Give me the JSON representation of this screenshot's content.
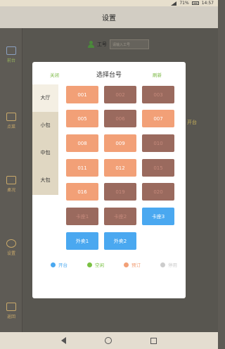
{
  "status_bar": {
    "battery": "71%",
    "time": "14:57"
  },
  "header": {
    "title": "设置"
  },
  "employee": {
    "label": "工号",
    "placeholder": "请输入工号"
  },
  "sidebar": {
    "items": [
      {
        "label": "前台",
        "icon": "cashier-icon"
      },
      {
        "label": "点菜",
        "icon": "dish-icon"
      },
      {
        "label": "桌况",
        "icon": "table-icon"
      },
      {
        "label": "设置",
        "icon": "gear-icon"
      },
      {
        "label": "返回",
        "icon": "return-icon"
      }
    ]
  },
  "background_hint": "开台",
  "modal": {
    "title": "选择台号",
    "close_label": "关闭",
    "refresh_label": "刷新",
    "tabs": [
      {
        "label": "大厅"
      },
      {
        "label": "小包"
      },
      {
        "label": "中包"
      },
      {
        "label": "大包"
      }
    ],
    "tables": [
      {
        "label": "001",
        "status": "reserved"
      },
      {
        "label": "002",
        "status": "inuse"
      },
      {
        "label": "003",
        "status": "inuse"
      },
      {
        "label": "005",
        "status": "reserved"
      },
      {
        "label": "006",
        "status": "inuse"
      },
      {
        "label": "007",
        "status": "reserved"
      },
      {
        "label": "008",
        "status": "reserved"
      },
      {
        "label": "009",
        "status": "reserved"
      },
      {
        "label": "010",
        "status": "inuse"
      },
      {
        "label": "011",
        "status": "reserved"
      },
      {
        "label": "012",
        "status": "reserved"
      },
      {
        "label": "015",
        "status": "inuse"
      },
      {
        "label": "016",
        "status": "reserved"
      },
      {
        "label": "019",
        "status": "inuse"
      },
      {
        "label": "020",
        "status": "inuse"
      },
      {
        "label": "卡座1",
        "status": "inuse"
      },
      {
        "label": "卡座2",
        "status": "inuse"
      },
      {
        "label": "卡座3",
        "status": "open"
      },
      {
        "label": "外卖1",
        "status": "open"
      },
      {
        "label": "外卖2",
        "status": "open"
      }
    ],
    "legend": [
      {
        "label": "开台",
        "color": "#4aa8f0"
      },
      {
        "label": "空闲",
        "color": "#7ac143"
      },
      {
        "label": "预订",
        "color": "#f2a077"
      },
      {
        "label": "停用",
        "color": "#cccccc"
      }
    ]
  },
  "colors": {
    "reserved": "#f2a077",
    "inuse": "#9a6a5e",
    "open": "#4aa8f0",
    "accent_green": "#7ab843"
  }
}
